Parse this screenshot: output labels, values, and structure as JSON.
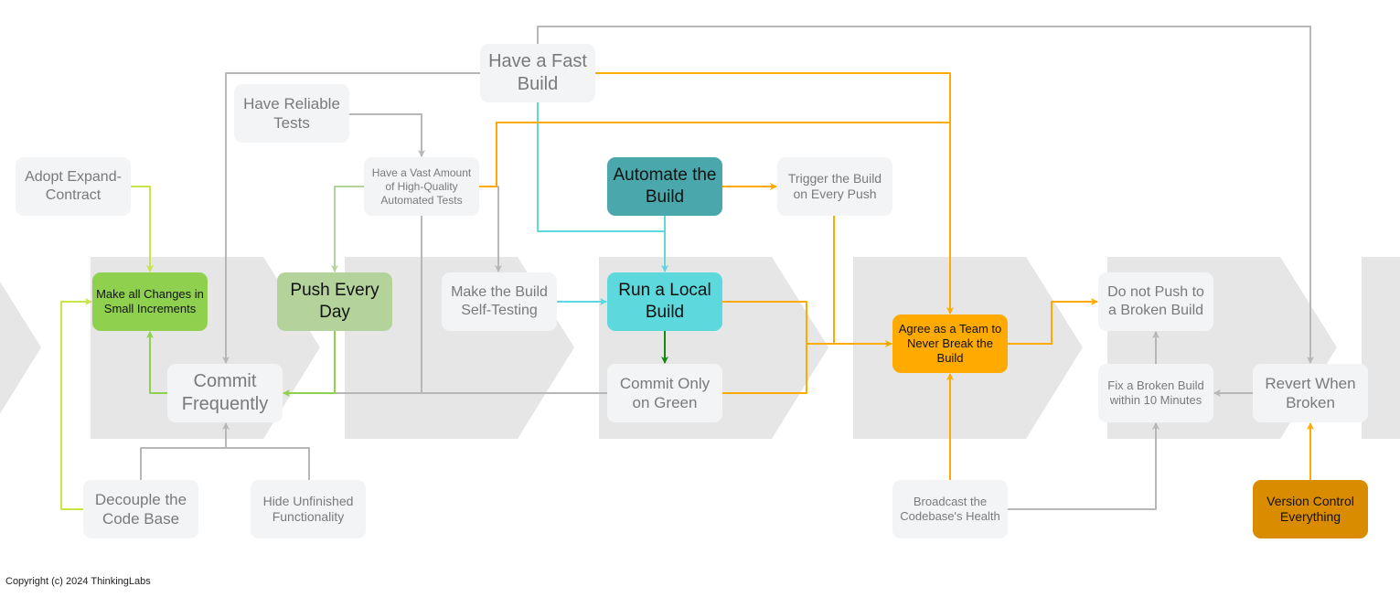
{
  "colors": {
    "stage_background": "#e6e6e6",
    "node_default": "#f3f4f6",
    "connector_gray": "#b7b7b7",
    "connector_lime": "#c8e64a",
    "connector_green": "#8fd14f",
    "connector_light_green": "#b3d39a",
    "connector_teal": "#5dd8dc",
    "connector_dark_green": "#148a14",
    "connector_orange": "#ffaa00"
  },
  "nodes": {
    "fast_build": {
      "label": "Have a Fast Build"
    },
    "reliable_tests": {
      "label": "Have Reliable Tests"
    },
    "vast_tests": {
      "label": "Have a Vast Amount of  High-Quality Automated Tests"
    },
    "expand_contract": {
      "label": "Adopt Expand-Contract"
    },
    "automate_build": {
      "label": "Automate the Build",
      "color": "#4aa8ad"
    },
    "trigger_build": {
      "label": "Trigger the Build on Every Push"
    },
    "small_increments": {
      "label": "Make all Changes in Small Increments",
      "color": "#8fd14f"
    },
    "push_every_day": {
      "label": "Push Every Day",
      "color": "#b3d39a"
    },
    "self_testing": {
      "label": "Make the Build Self-Testing"
    },
    "local_build": {
      "label": "Run a Local Build",
      "color": "#5dd8dc"
    },
    "commit_frequently": {
      "label": "Commit Frequently"
    },
    "commit_on_green": {
      "label": "Commit Only on Green"
    },
    "never_break": {
      "label": "Agree as a Team to Never Break the Build",
      "color": "#ffaa00"
    },
    "no_push_broken": {
      "label": "Do not Push to a Broken Build"
    },
    "fix_broken": {
      "label": "Fix a Broken Build within 10 Minutes"
    },
    "revert": {
      "label": "Revert When Broken"
    },
    "decouple": {
      "label": "Decouple the Code Base"
    },
    "hide_unfinished": {
      "label": "Hide Unfinished Functionality"
    },
    "broadcast": {
      "label": "Broadcast the Codebase's Health"
    },
    "version_control": {
      "label": "Version Control Everything",
      "color": "#d98c00"
    }
  },
  "footer": {
    "copyright": "Copyright (c) 2024 ThinkingLabs"
  }
}
